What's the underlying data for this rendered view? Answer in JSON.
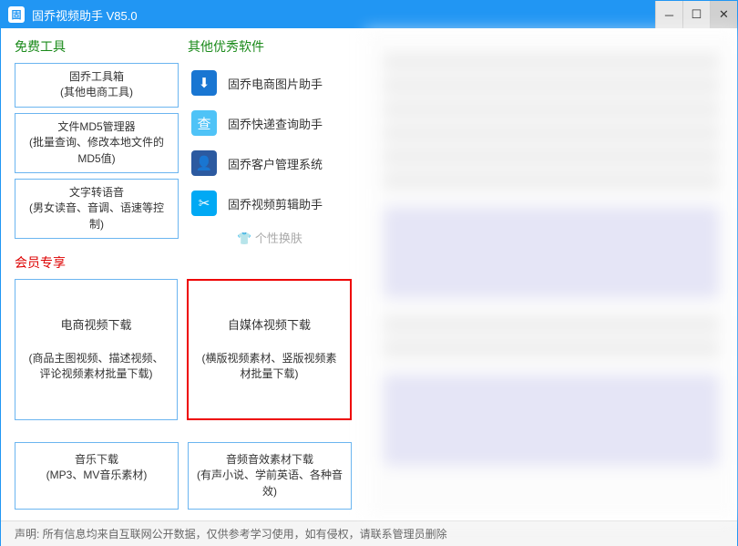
{
  "titlebar": {
    "title": "固乔视频助手 V85.0",
    "icon_text": "固"
  },
  "sections": {
    "free_tools": "免费工具",
    "other_software": "其他优秀软件",
    "member": "会员专享",
    "skin": "个性换肤"
  },
  "free_tools": [
    {
      "main": "固乔工具箱",
      "sub": "(其他电商工具)"
    },
    {
      "main": "文件MD5管理器",
      "sub": "(批量查询、修改本地文件的MD5值)"
    },
    {
      "main": "文字转语音",
      "sub": "(男女读音、音调、语速等控制)"
    }
  ],
  "other_software": [
    {
      "icon": "download-icon",
      "label": "固乔电商图片助手"
    },
    {
      "icon": "express-icon",
      "label": "固乔快递查询助手"
    },
    {
      "icon": "user-icon",
      "label": "固乔客户管理系统"
    },
    {
      "icon": "scissors-icon",
      "label": "固乔视频剪辑助手"
    }
  ],
  "member_cards": [
    {
      "main": "电商视频下载",
      "sub": "(商品主图视频、描述视频、评论视频素材批量下载)"
    },
    {
      "main": "自媒体视频下载",
      "sub": "(横版视频素材、竖版视频素材批量下载)"
    }
  ],
  "download_cards": [
    {
      "main": "音乐下载",
      "sub": "(MP3、MV音乐素材)"
    },
    {
      "main": "音频音效素材下载",
      "sub": "(有声小说、学前英语、各种音效)"
    }
  ],
  "footer": "声明: 所有信息均来自互联网公开数据，仅供参考学习使用，如有侵权，请联系管理员删除"
}
